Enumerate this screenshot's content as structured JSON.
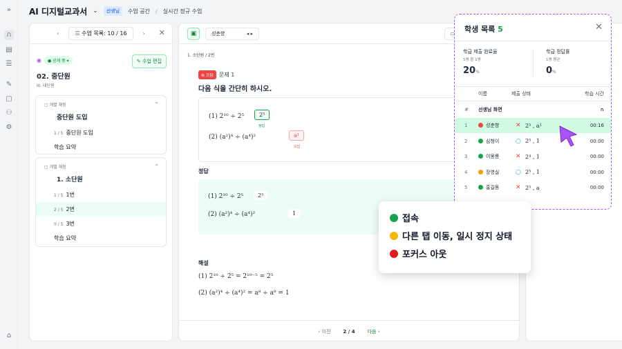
{
  "app": {
    "title": "AI 디지털교과서",
    "role_tag": "선생님",
    "breadcrumb": [
      "수업 공간",
      "실시간 정규 수업"
    ]
  },
  "rail": {
    "icons": [
      "expand-icon",
      "headset-icon",
      "chart-icon",
      "list-icon",
      "pencil-icon",
      "document-icon",
      "people-icon",
      "settings-icon",
      "home-icon"
    ]
  },
  "left": {
    "nav_label": "수업 목록: 10 / 16",
    "visibility": "공개 중",
    "edit_label": "수업 편집",
    "unit_title": "02. 중단원",
    "unit_sub": "III. 대단원",
    "sections": [
      {
        "tag": "개별 채점",
        "title": "중단원 도입",
        "items": [
          {
            "n": "1 / 5",
            "label": "중단원 도입"
          },
          {
            "n": "",
            "label": "학습 요약"
          }
        ]
      },
      {
        "tag": "개별 채점",
        "title": "1. 소단원",
        "items": [
          {
            "n": "1 / 5",
            "label": "1번"
          },
          {
            "n": "2 / 5",
            "label": "2번"
          },
          {
            "n": "0 / 5",
            "label": "3번"
          },
          {
            "n": "",
            "label": "학습 요약"
          }
        ]
      }
    ]
  },
  "center": {
    "student": "성춘향",
    "crumb": [
      "1. 소단원",
      "2번"
    ],
    "wrong_badge": "오답",
    "problem_label": "문제 1",
    "prompt": "다음 식을 간단히 하시오.",
    "q1": "(1) 2¹⁰ ÷ 2⁵",
    "q2": "(2) (a²)⁴ ÷ (a⁴)²",
    "a1": "2⁵",
    "a1_tag": "정답",
    "a2": "a¹",
    "a2_tag": "오답",
    "answer_heading": "정답",
    "ans1": "2⁵",
    "ans2": "1",
    "explain_heading": "해설",
    "exp1": "(1) 2¹⁰ ÷ 2⁵ = 2¹⁰⁻⁵ = 2⁵",
    "exp2": "(2) (a²)⁴ ÷ (a⁴)² = a⁸ ÷ a⁸ = 1",
    "prev": "이전",
    "page": "2 / 4",
    "next": "다음"
  },
  "panel": {
    "title": "학생 목록",
    "count": "5",
    "stat1_label": "학급 제출 완료율",
    "stat1_sub": "5명 중 1명",
    "stat1_value": "20",
    "stat1_unit": "%",
    "stat2_label": "학급 정답률",
    "stat2_sub": "1명 평균",
    "stat2_value": "0",
    "stat2_unit": "%",
    "cols": [
      "이름",
      "제출 상태",
      "학습 시간"
    ],
    "hash": "#",
    "teacher_label": "선생님 화면",
    "rows": [
      {
        "no": "1",
        "name": "성춘향",
        "status": "#ef4444",
        "mark": "✕",
        "answer": "2⁵ , a¹",
        "time": "00:16"
      },
      {
        "no": "2",
        "name": "심청이",
        "status": "#16a34a",
        "mark": "○",
        "answer": "2⁵ , 1",
        "time": "00:00"
      },
      {
        "no": "3",
        "name": "이몽룡",
        "status": "#16a34a",
        "mark": "✕",
        "answer": "2⁴ , 1",
        "time": "00:00"
      },
      {
        "no": "4",
        "name": "장영실",
        "status": "#f59e0b",
        "mark": "○",
        "answer": "2⁵ , 1",
        "time": "00:00"
      },
      {
        "no": "5",
        "name": "홍길동",
        "status": "#16a34a",
        "mark": "✕",
        "answer": "2⁵ , a",
        "time": "00:00"
      }
    ]
  },
  "legend": [
    {
      "color": "#16a34a",
      "label": "접속"
    },
    {
      "color": "#f5b800",
      "label": "다른 탭 이동, 일시 정지 상태"
    },
    {
      "color": "#e11d1d",
      "label": "포커스 아웃"
    }
  ]
}
